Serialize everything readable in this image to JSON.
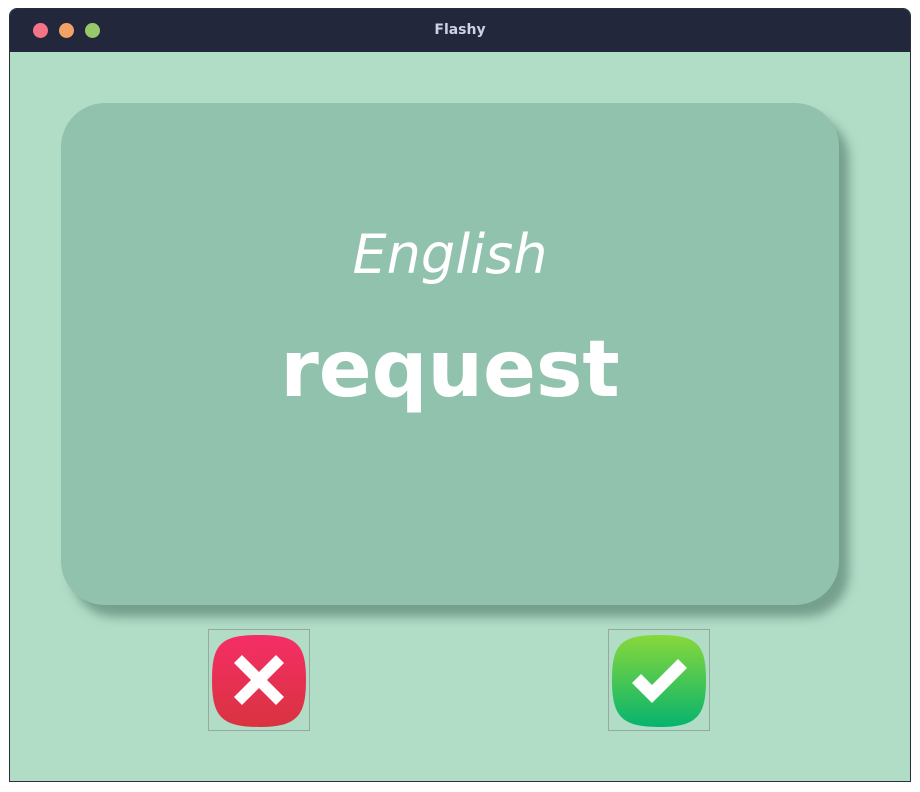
{
  "window": {
    "title": "Flashy"
  },
  "card": {
    "language": "English",
    "word": "request"
  },
  "buttons": {
    "wrong_icon": "cross-icon",
    "right_icon": "checkmark-icon"
  },
  "colors": {
    "background": "#b1ddc7",
    "card": "#91c2ae",
    "titlebar": "#22273b",
    "wrong": "#e8325a",
    "right": "#2ec460"
  }
}
